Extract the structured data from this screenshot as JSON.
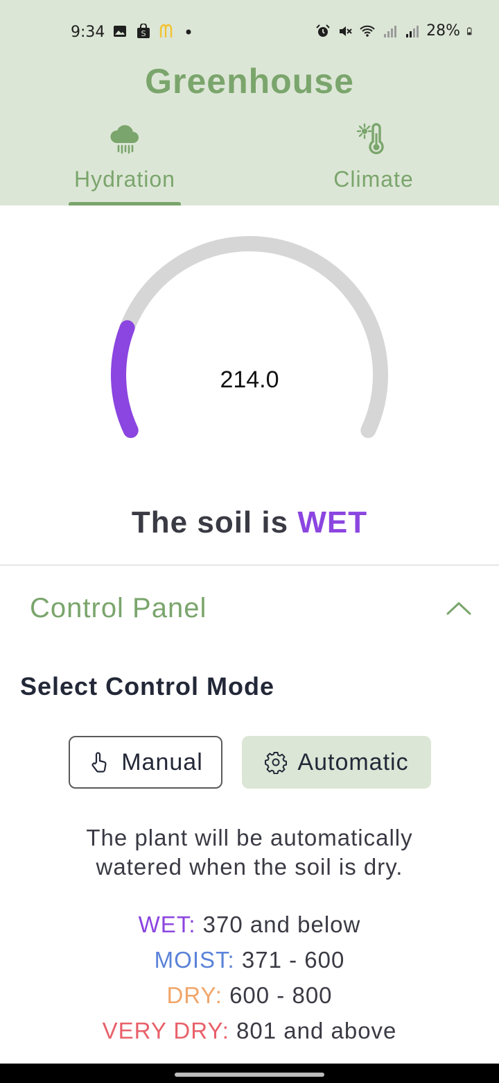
{
  "status_bar": {
    "time": "9:34",
    "battery": "28%",
    "left_icons": [
      "image-icon",
      "shopping-bag-icon",
      "mcdonalds-icon",
      "dot-icon"
    ],
    "right_icons": [
      "alarm-icon",
      "mute-icon",
      "wifi-icon",
      "signal-icon",
      "signal-icon",
      "battery-icon"
    ]
  },
  "app": {
    "title": "Greenhouse"
  },
  "tabs": [
    {
      "label": "Hydration",
      "icon": "rain-cloud-icon",
      "selected": true
    },
    {
      "label": "Climate",
      "icon": "thermometer-sun-icon",
      "selected": false
    }
  ],
  "gauge": {
    "value": "214.0",
    "fill_fraction": 0.2,
    "track_color": "#d6d6d6",
    "fill_color": "#8b45e0"
  },
  "soil": {
    "prefix": "The soil is",
    "state": "WET"
  },
  "control_panel": {
    "title": "Control Panel",
    "expanded": true,
    "mode_title": "Select Control Mode",
    "manual_label": "Manual",
    "automatic_label": "Automatic",
    "selected_mode": "Automatic",
    "description": "The plant will be automatically watered when the soil is dry."
  },
  "legend": [
    {
      "label": "WET:",
      "range": "370 and below",
      "color": "#8b45e0"
    },
    {
      "label": "MOIST:",
      "range": "371 - 600",
      "color": "#5a82d8"
    },
    {
      "label": "DRY:",
      "range": "600 - 800",
      "color": "#f0a66a"
    },
    {
      "label": "VERY DRY:",
      "range": "801 and above",
      "color": "#e8606a"
    }
  ],
  "colors": {
    "accent_green": "#7aa56c",
    "header_bg": "#dce6d6"
  }
}
